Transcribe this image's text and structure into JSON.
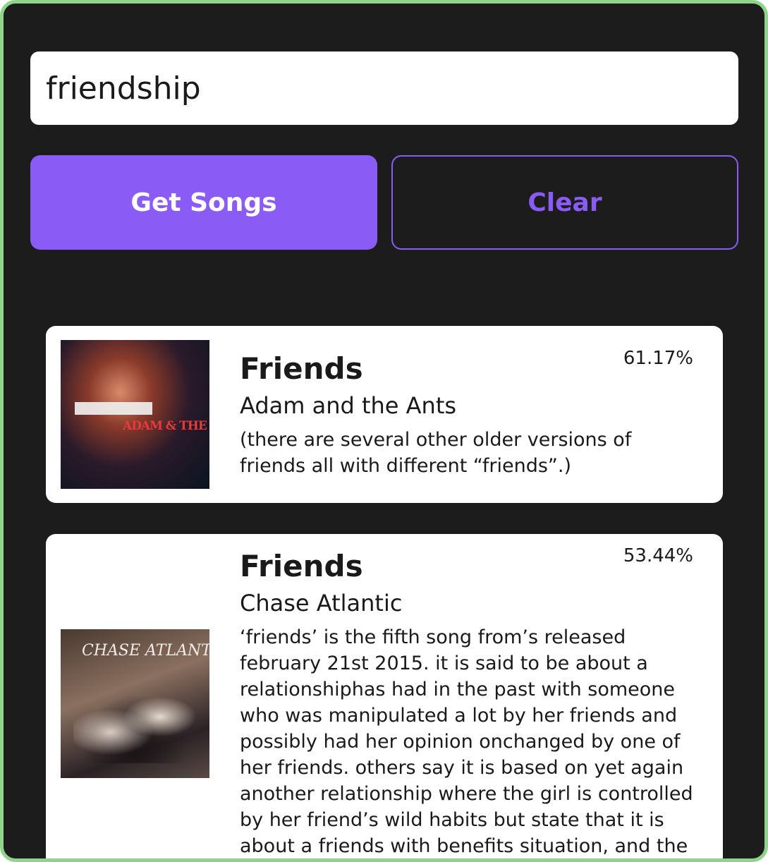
{
  "search": {
    "value": "friendship",
    "placeholder": ""
  },
  "buttons": {
    "get_songs": "Get Songs",
    "clear": "Clear"
  },
  "colors": {
    "accent": "#8a5cf5",
    "background": "#1c1c1c",
    "frame_border": "#8fd48a"
  },
  "results": [
    {
      "title": "Friends",
      "artist": "Adam and the Ants",
      "score": "61.17%",
      "description": "(there are several other  older versions of friends  all with different “friends”.)",
      "cover_text": "ADAM & THE ANTS"
    },
    {
      "title": "Friends",
      "artist": "Chase Atlantic",
      "score": "53.44%",
      "description": "‘friends’ is the fifth song from’s  released february 21st  2015. it is said to be about a relationshiphas had in the past with someone who was manipulated a lot by her friends  and possibly had her opinion onchanged by one of her friends. others say it is based on yet again another relationship where the girl is controlled by her friend’s wild habits  but state that it is about a friends with benefits situation, and the",
      "cover_text": "CHASE ATLANTIC"
    }
  ]
}
